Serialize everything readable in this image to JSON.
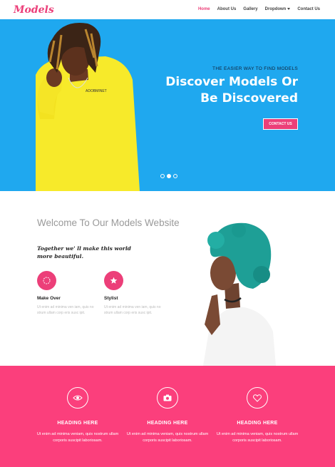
{
  "header": {
    "logo": "Models",
    "nav": [
      {
        "label": "Home",
        "active": true
      },
      {
        "label": "About Us"
      },
      {
        "label": "Gallery"
      },
      {
        "label": "Dropdown"
      },
      {
        "label": "Contact Us"
      }
    ]
  },
  "hero": {
    "subtitle": "THE EASIER WAY TO FIND MODELS",
    "title_line1": "Discover Models Or",
    "title_line2": "Be Discovered",
    "button": "CONTACT US",
    "slides": 3,
    "active_slide": 2
  },
  "welcome": {
    "title": "Welcome To Our Models Website",
    "quote": "Together we' ll make this world more beautiful.",
    "features": [
      {
        "icon": "makeup-icon",
        "label": "Make Over",
        "desc": "Ut enim ad minima ven iam, quis no strum ullam corp eris susc ipit."
      },
      {
        "icon": "star-icon",
        "label": "Stylist",
        "desc": "Ut enim ad minima ven iam, quis no strum ullam corp eris susc ipit."
      }
    ]
  },
  "services": [
    {
      "icon": "eye-icon",
      "heading": "HEADING HERE",
      "text": "Ut enim ad minima veniam, quis nostrum ullam corporis suscipit laboriosam."
    },
    {
      "icon": "camera-icon",
      "heading": "HEADING HERE",
      "text": "Ut enim ad minima veniam, quis nostrum ullam corporis suscipit laboriosam."
    },
    {
      "icon": "heart-icon",
      "heading": "HEADING HERE",
      "text": "Ut enim ad minima veniam, quis nostrum ullam corporis suscipit laboriosam."
    }
  ],
  "colors": {
    "accent": "#ec3f79",
    "hero_bg": "#1fa8ef",
    "section_bg": "#fb3f7c"
  }
}
